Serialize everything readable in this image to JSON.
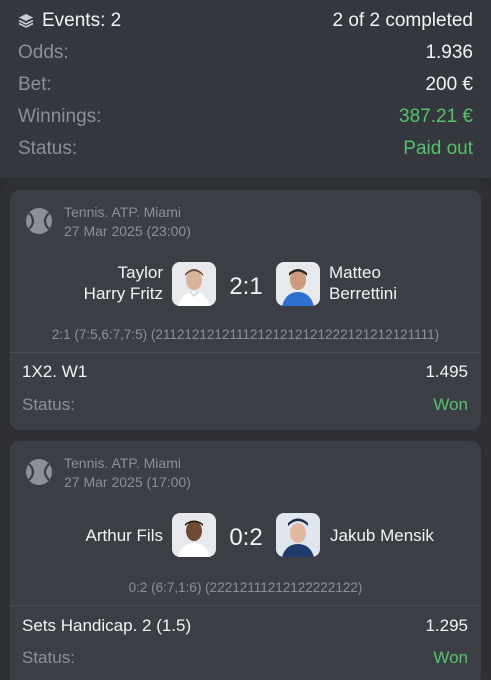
{
  "summary": {
    "events_icon": "layers-icon",
    "events_label": "Events: 2",
    "completed": "2 of 2 completed",
    "odds_label": "Odds:",
    "odds_value": "1.936",
    "bet_label": "Bet:",
    "bet_value": "200 €",
    "winnings_label": "Winnings:",
    "winnings_value": "387.21 €",
    "status_label": "Status:",
    "status_value": "Paid out"
  },
  "events": [
    {
      "sport_icon": "tennis-ball-icon",
      "league": "Tennis. ATP. Miami",
      "datetime": "27 Mar 2025 (23:00)",
      "player1_line1": "Taylor",
      "player1_line2": "Harry Fritz",
      "score": "2:1",
      "player2_line1": "Matteo",
      "player2_line2": "Berrettini",
      "details": "2:1 (7:5,6:7,7:5) (21121212121112121212121222121212121111)",
      "market": "1X2. W1",
      "odds": "1.495",
      "status_label": "Status:",
      "status_value": "Won"
    },
    {
      "sport_icon": "tennis-ball-icon",
      "league": "Tennis. ATP. Miami",
      "datetime": "27 Mar 2025 (17:00)",
      "player1": "Arthur Fils",
      "score": "0:2",
      "player2": "Jakub Mensik",
      "details": "0:2 (6:7,1:6) (22212111212122222122)",
      "market": "Sets Handicap. 2 (1.5)",
      "odds": "1.295",
      "status_label": "Status:",
      "status_value": "Won"
    }
  ],
  "colors": {
    "background": "#2a2c31",
    "card": "#3b3e44",
    "muted": "#8d9097",
    "green": "#56c16a"
  }
}
